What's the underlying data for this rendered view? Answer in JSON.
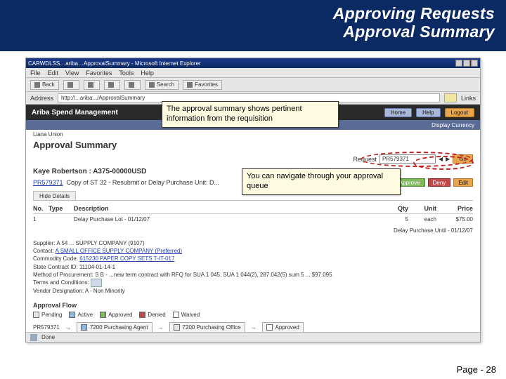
{
  "slide": {
    "title1": "Approving Requests",
    "title2": "Approval Summary",
    "footer": "Page - 28"
  },
  "callouts": {
    "c1": "The approval summary shows pertinent information from the requisition",
    "c2": "You can navigate through your approval queue"
  },
  "browser": {
    "window_title": "CARWDLSS…ariba…ApprovalSummary - Microsoft Internet Explorer",
    "menus": [
      "File",
      "Edit",
      "View",
      "Favorites",
      "Tools",
      "Help"
    ],
    "toolbar": {
      "back": "Back",
      "search": "Search",
      "favorites": "Favorites"
    },
    "address_label": "Address",
    "address_value": "http://...ariba.../ApprovalSummary",
    "links": "Links",
    "status": "Done"
  },
  "ariba": {
    "brand": "Ariba Spend Management",
    "buttons": {
      "home": "Home",
      "help": "Help",
      "logout": "Logout"
    },
    "currency": "Display Currency",
    "userline": "Liana Union"
  },
  "page": {
    "heading": "Approval Summary",
    "request_label": "Request",
    "request_value": "PR579371",
    "go": "Go",
    "owner": "Kaye Robertson : A375-00000USD",
    "id_link": "PR579371",
    "id_desc": "Copy of ST 32 - Resubmit or Delay Purchase Unit: D...",
    "actions": {
      "approve": "Approve",
      "deny": "Deny",
      "edit": "Edit"
    },
    "tab": "Hide Details",
    "headers": {
      "no": "No.",
      "type": "Type",
      "desc": "Description",
      "qty": "Qty",
      "unit": "Unit",
      "price": "Price"
    },
    "row": {
      "no": "1",
      "type": "",
      "desc": "Delay Purchase Lot - 01/12/07",
      "qty": "5",
      "unit": "each",
      "price": "$75.00"
    },
    "delay_until": "Delay Purchase Until - 01/12/07",
    "details": {
      "supplier_lbl": "Supplier:",
      "supplier": "A 54 ... SUPPLY COMPANY (9107)",
      "contact_lbl": "Contact:",
      "contact": "A SMALL OFFICE SUPPLY COMPANY (Preferred)",
      "commodity_lbl": "Commodity Code:",
      "commodity": "615230 PAPER COPY SETS T-IT-017",
      "contract_lbl": "State Contract ID:",
      "contract": "11104-01-14-1",
      "method_lbl": "Method of Procurement:",
      "method": "S  B - ...new term contract with RFQ for SUA 1 045, SUA 1 044(2), 287.042(5) sum 5 ... $97.095",
      "terms_lbl": "Terms and Conditions:",
      "vendor_lbl": "Vendor Designation:",
      "vendor": "A - Non Minority"
    },
    "flow": {
      "header": "Approval Flow",
      "legend": {
        "pending": "Pending",
        "active": "Active",
        "approved": "Approved",
        "denied": "Denied",
        "waived": "Waived"
      },
      "start": "PR579371",
      "node1": "7200 Purchasing Agent",
      "node2": "7200 Purchasing Office",
      "end": "Approved"
    }
  }
}
